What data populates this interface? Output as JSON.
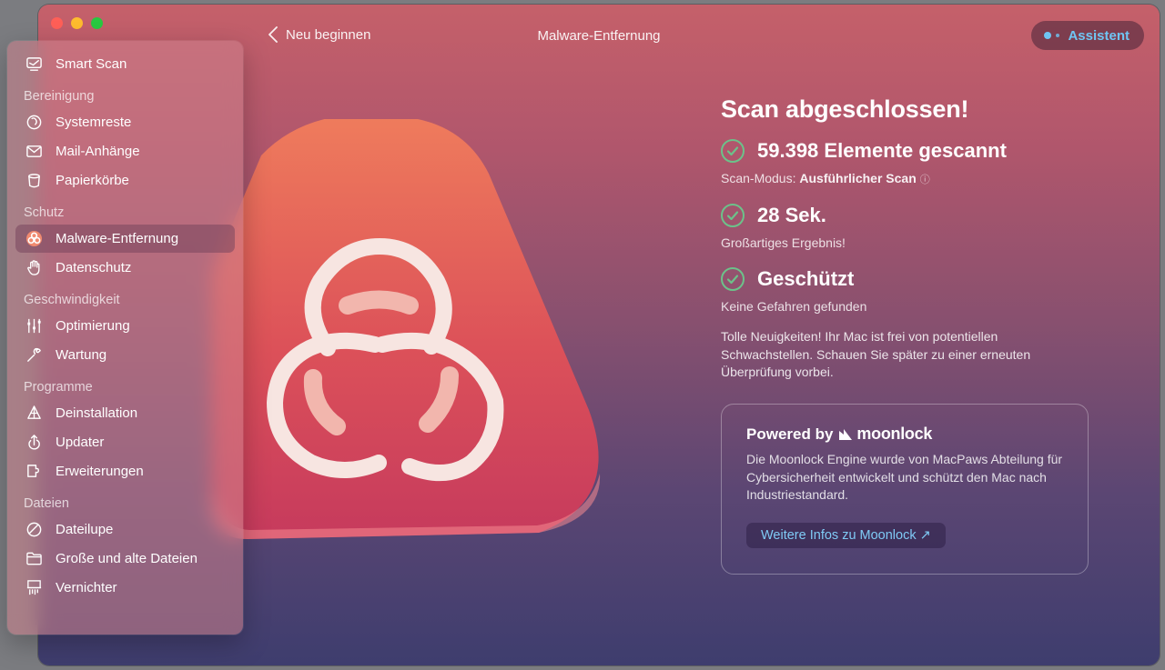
{
  "window": {
    "back_label": "Neu beginnen",
    "title": "Malware-Entfernung",
    "assistant_label": "Assistent"
  },
  "sidebar": {
    "smart_scan": "Smart Scan",
    "sections": [
      {
        "title": "Bereinigung",
        "items": [
          {
            "label": "Systemreste",
            "icon": "system-junk-icon"
          },
          {
            "label": "Mail-Anhänge",
            "icon": "mail-icon"
          },
          {
            "label": "Papierkörbe",
            "icon": "trash-icon"
          }
        ]
      },
      {
        "title": "Schutz",
        "items": [
          {
            "label": "Malware-Entfernung",
            "icon": "biohazard-icon",
            "active": true
          },
          {
            "label": "Datenschutz",
            "icon": "hand-icon"
          }
        ]
      },
      {
        "title": "Geschwindigkeit",
        "items": [
          {
            "label": "Optimierung",
            "icon": "sliders-icon"
          },
          {
            "label": "Wartung",
            "icon": "wrench-icon"
          }
        ]
      },
      {
        "title": "Programme",
        "items": [
          {
            "label": "Deinstallation",
            "icon": "uninstall-icon"
          },
          {
            "label": "Updater",
            "icon": "updater-icon"
          },
          {
            "label": "Erweiterungen",
            "icon": "extensions-icon"
          }
        ]
      },
      {
        "title": "Dateien",
        "items": [
          {
            "label": "Dateilupe",
            "icon": "space-lens-icon"
          },
          {
            "label": "Große und alte Dateien",
            "icon": "folder-icon"
          },
          {
            "label": "Vernichter",
            "icon": "shredder-icon"
          }
        ]
      }
    ]
  },
  "results": {
    "heading": "Scan abgeschlossen!",
    "items_scanned": "59.398 Elemente gescannt",
    "scan_mode_prefix": "Scan-Modus:",
    "scan_mode_value": "Ausführlicher Scan",
    "duration": "28 Sek.",
    "duration_note": "Großartiges Ergebnis!",
    "protected": "Geschützt",
    "protected_note": "Keine Gefahren gefunden",
    "news": "Tolle Neuigkeiten! Ihr Mac ist frei von potentiellen Schwachstellen. Schauen Sie später zu einer erneuten Überprüfung vorbei."
  },
  "moonlock": {
    "powered_by": "Powered by",
    "brand": "moonlock",
    "description": "Die Moonlock Engine wurde von MacPaws Abteilung für Cybersicherheit entwickelt und schützt den Mac nach Industriestandard.",
    "button": "Weitere Infos zu Moonlock ↗"
  },
  "colors": {
    "accent_blue": "#6fc5f3",
    "check_green": "#6cc28a",
    "triangle_top": "#ef7c5c",
    "triangle_bottom": "#c63a5d"
  }
}
